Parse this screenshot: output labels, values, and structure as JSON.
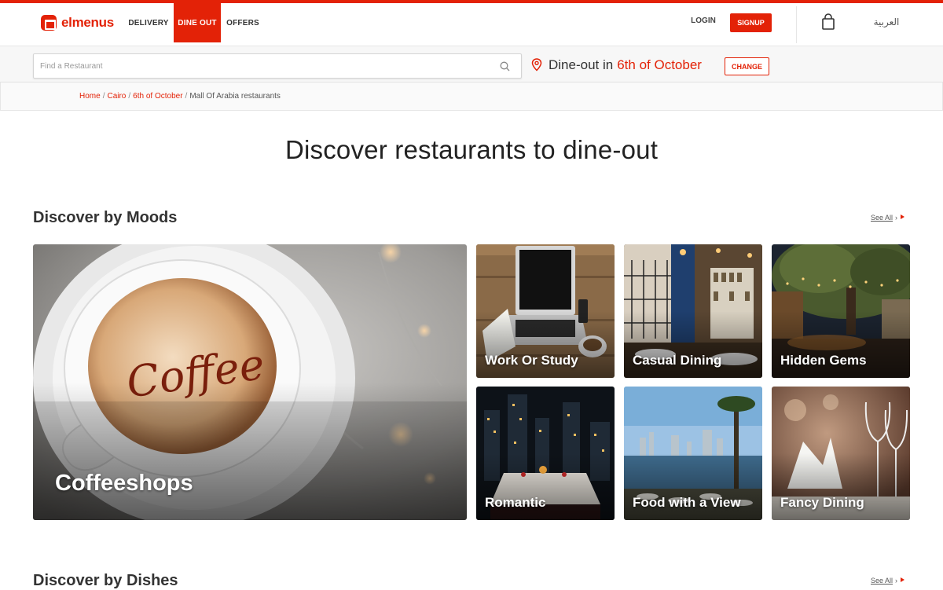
{
  "header": {
    "logo_text": "elmenus",
    "tabs": [
      {
        "label": "DELIVERY"
      },
      {
        "label": "DINE OUT"
      },
      {
        "label": "OFFERS"
      }
    ],
    "login_label": "LOGIN",
    "signup_label": "SIGNUP",
    "language_label": "العربية"
  },
  "search": {
    "placeholder": "Find a Restaurant",
    "value": "",
    "dineout_prefix": "Dine-out in",
    "city": "6th of October",
    "change_label": "CHANGE"
  },
  "breadcrumb": {
    "items": [
      {
        "label": "Home"
      },
      {
        "label": "Cairo"
      },
      {
        "label": "6th of October"
      }
    ],
    "current": "Mall Of Arabia restaurants",
    "separator": "/"
  },
  "main": {
    "hero_title": "Discover restaurants to dine-out",
    "moods": {
      "title": "Discover by Moods",
      "see_all_label": "See All",
      "cards": [
        {
          "label": "Coffeeshops",
          "image": "coffee-cup-image"
        },
        {
          "label": "Work Or Study",
          "image": "laptop-desk-image"
        },
        {
          "label": "Casual Dining",
          "image": "restaurant-interior-image"
        },
        {
          "label": "Hidden Gems",
          "image": "garden-tree-lights-image"
        },
        {
          "label": "Romantic",
          "image": "candlelit-table-city-night-image"
        },
        {
          "label": "Food with a View",
          "image": "waterfront-skyline-image"
        },
        {
          "label": "Fancy Dining",
          "image": "wine-glasses-napkin-image"
        }
      ]
    },
    "dishes": {
      "title": "Discover by Dishes",
      "see_all_label": "See All"
    }
  },
  "colors": {
    "brand": "#e32207",
    "text": "#333333"
  }
}
